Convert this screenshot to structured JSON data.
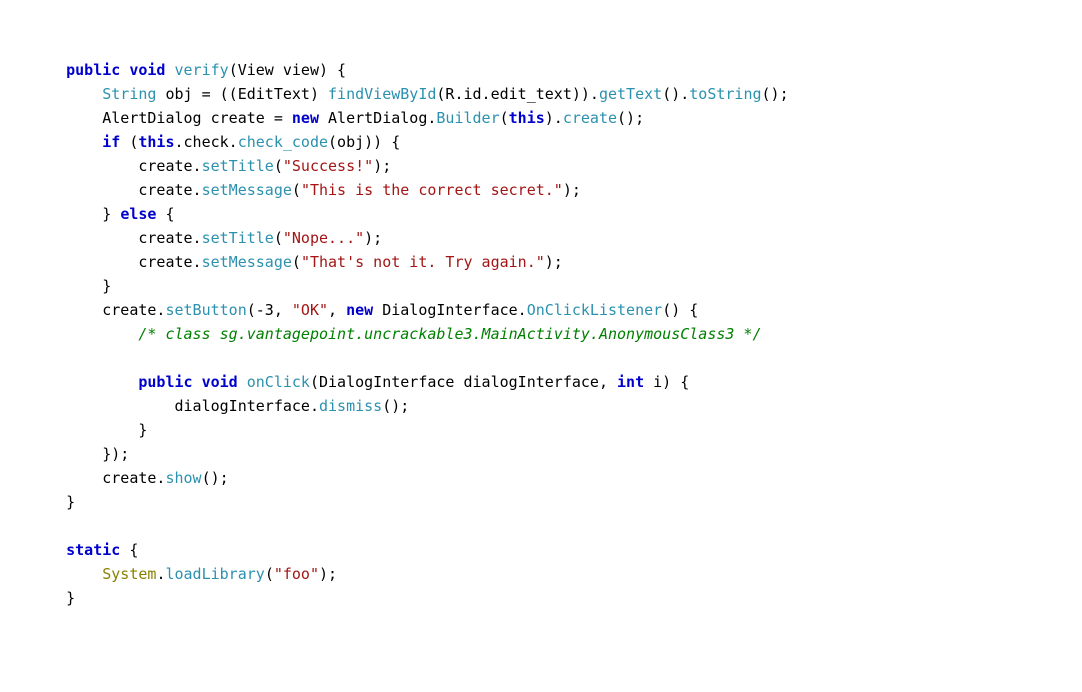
{
  "code": {
    "l1_public": "public",
    "l1_void": "void",
    "l1_verify": "verify",
    "l1_rest": "(View view) {",
    "l2_string": "String",
    "l2_part1": " obj = ((EditText) ",
    "l2_findview": "findViewById",
    "l2_part2": "(R.id.edit_text)).",
    "l2_gettext": "getText",
    "l2_part3": "().",
    "l2_tostring": "toString",
    "l2_part4": "();",
    "l3_part1": "AlertDialog create = ",
    "l3_new": "new",
    "l3_part2": " AlertDialog.",
    "l3_builder": "Builder",
    "l3_part3": "(",
    "l3_this": "this",
    "l3_part4": ").",
    "l3_create": "create",
    "l3_part5": "();",
    "l4_if": "if",
    "l4_part1": " (",
    "l4_this": "this",
    "l4_part2": ".check.",
    "l4_checkcode": "check_code",
    "l4_part3": "(obj)) {",
    "l5_part1": "create.",
    "l5_settitle": "setTitle",
    "l5_part2": "(",
    "l5_str": "\"Success!\"",
    "l5_part3": ");",
    "l6_part1": "create.",
    "l6_setmessage": "setMessage",
    "l6_part2": "(",
    "l6_str": "\"This is the correct secret.\"",
    "l6_part3": ");",
    "l7_part1": "} ",
    "l7_else": "else",
    "l7_part2": " {",
    "l8_part1": "create.",
    "l8_settitle": "setTitle",
    "l8_part2": "(",
    "l8_str": "\"Nope...\"",
    "l8_part3": ");",
    "l9_part1": "create.",
    "l9_setmessage": "setMessage",
    "l9_part2": "(",
    "l9_str": "\"That's not it. Try again.\"",
    "l9_part3": ");",
    "l10": "}",
    "l11_part1": "create.",
    "l11_setbutton": "setButton",
    "l11_part2": "(-3, ",
    "l11_str": "\"OK\"",
    "l11_part3": ", ",
    "l11_new": "new",
    "l11_part4": " DialogInterface.",
    "l11_listener": "OnClickListener",
    "l11_part5": "() {",
    "l12_comment": "/* class sg.vantagepoint.uncrackable3.MainActivity.AnonymousClass3 */",
    "l13": "",
    "l14_public": "public",
    "l14_void": "void",
    "l14_onclick": "onClick",
    "l14_part1": "(DialogInterface dialogInterface, ",
    "l14_int": "int",
    "l14_part2": " i) {",
    "l15_part1": "dialogInterface.",
    "l15_dismiss": "dismiss",
    "l15_part2": "();",
    "l16": "}",
    "l17": "});",
    "l18_part1": "create.",
    "l18_show": "show",
    "l18_part2": "();",
    "l19": "}",
    "l20": "",
    "l21_static": "static",
    "l21_brace": " {",
    "l22_system": "System",
    "l22_part1": ".",
    "l22_loadlib": "loadLibrary",
    "l22_part2": "(",
    "l22_str": "\"foo\"",
    "l22_part3": ");",
    "l23": "}"
  }
}
